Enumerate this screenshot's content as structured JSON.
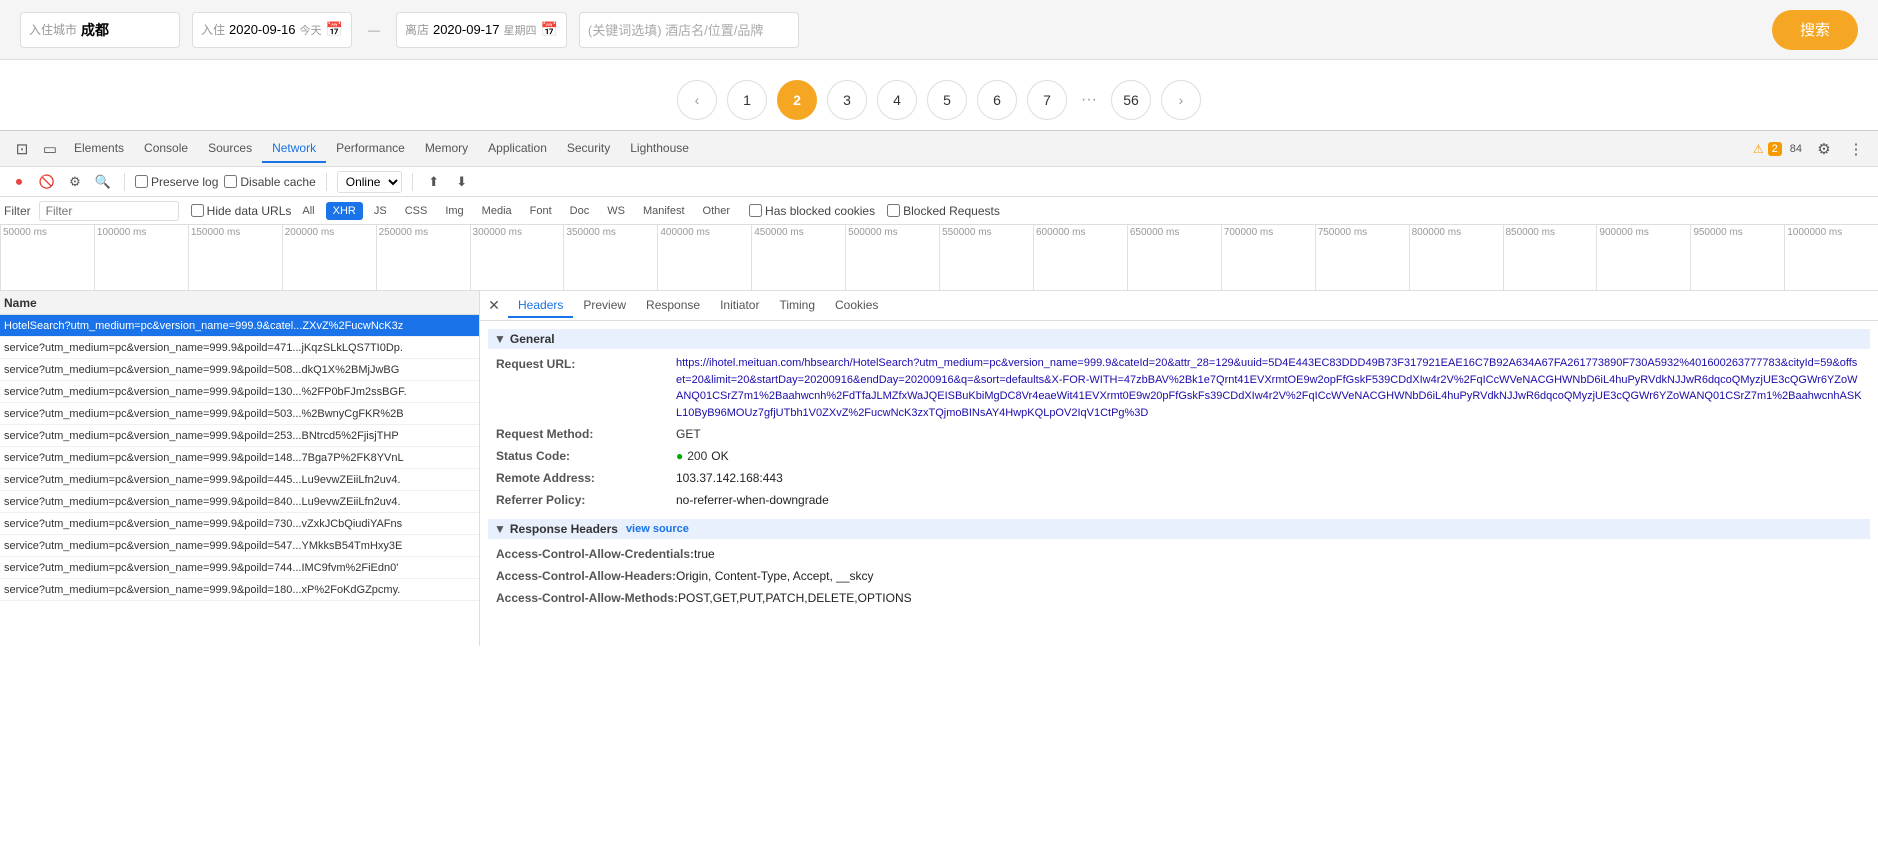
{
  "topbar": {
    "checkin_label": "入住城市",
    "checkin_city": "成都",
    "checkin_date_label": "入住",
    "checkin_date": "2020-09-16",
    "today_label": "今天",
    "checkout_label": "离店",
    "checkout_date": "2020-09-17",
    "checkout_day": "星期四",
    "keyword_placeholder": "(关键词选填) 酒店名/位置/品牌",
    "search_btn": "搜索"
  },
  "pagination": {
    "prev": "‹",
    "next": "›",
    "pages": [
      "1",
      "2",
      "3",
      "4",
      "5",
      "6",
      "7",
      "...",
      "56"
    ],
    "active_page": "2"
  },
  "devtools": {
    "tabs": [
      "Elements",
      "Console",
      "Sources",
      "Network",
      "Performance",
      "Memory",
      "Application",
      "Security",
      "Lighthouse"
    ],
    "active_tab": "Network",
    "warning_count": "2",
    "error_count": "84",
    "network_toolbar": {
      "preserve_log": "Preserve log",
      "disable_cache": "Disable cache",
      "throttle": "Online"
    },
    "filter_bar": {
      "label": "Filter",
      "hide_data_urls": "Hide data URLs",
      "all": "All",
      "xhr": "XHR",
      "js": "JS",
      "css": "CSS",
      "img": "Img",
      "media": "Media",
      "font": "Font",
      "doc": "Doc",
      "ws": "WS",
      "manifest": "Manifest",
      "other": "Other",
      "has_blocked": "Has blocked cookies",
      "blocked_requests": "Blocked Requests"
    },
    "timeline": {
      "ticks": [
        "50000 ms",
        "100000 ms",
        "150000 ms",
        "200000 ms",
        "250000 ms",
        "300000 ms",
        "350000 ms",
        "400000 ms",
        "450000 ms",
        "500000 ms",
        "550000 ms",
        "600000 ms",
        "650000 ms",
        "700000 ms",
        "750000 ms",
        "800000 ms",
        "850000 ms",
        "900000 ms",
        "950000 ms",
        "1000000 ms"
      ]
    },
    "list_header": "Name",
    "requests": [
      {
        "name": "HotelSearch?utm_medium=pc&version_name=999.9&catel...ZXvZ%2FucwNcK3z",
        "selected": true
      },
      {
        "name": "service?utm_medium=pc&version_name=999.9&poild=471...jKqzSLkLQS7TI0Dp.",
        "selected": false
      },
      {
        "name": "service?utm_medium=pc&version_name=999.9&poild=508...dkQ1X%2BMjJwBG",
        "selected": false
      },
      {
        "name": "service?utm_medium=pc&version_name=999.9&poild=130...%2FP0bFJm2ssBGF.",
        "selected": false
      },
      {
        "name": "service?utm_medium=pc&version_name=999.9&poild=503...%2BwnyCgFKR%2B",
        "selected": false
      },
      {
        "name": "service?utm_medium=pc&version_name=999.9&poild=253...BNtrcd5%2FjisjTHP",
        "selected": false
      },
      {
        "name": "service?utm_medium=pc&version_name=999.9&poild=148...7Bga7P%2FK8YVnL",
        "selected": false
      },
      {
        "name": "service?utm_medium=pc&version_name=999.9&poild=445...Lu9evwZEiiLfn2uv4.",
        "selected": false
      },
      {
        "name": "service?utm_medium=pc&version_name=999.9&poild=840...Lu9evwZEiiLfn2uv4.",
        "selected": false
      },
      {
        "name": "service?utm_medium=pc&version_name=999.9&poild=730...vZxkJCbQiudiYAFns",
        "selected": false
      },
      {
        "name": "service?utm_medium=pc&version_name=999.9&poild=547...YMkksB54TmHxy3E",
        "selected": false
      },
      {
        "name": "service?utm_medium=pc&version_name=999.9&poild=744...IMC9fvm%2FiEdn0'",
        "selected": false
      },
      {
        "name": "service?utm_medium=pc&version_name=999.9&poild=180...xP%2FoKdGZpcmy.",
        "selected": false
      }
    ],
    "details": {
      "tabs": [
        "Headers",
        "Preview",
        "Response",
        "Initiator",
        "Timing",
        "Cookies"
      ],
      "active_tab": "Headers",
      "general_section": "General",
      "request_url_label": "Request URL:",
      "request_url": "https://ihotel.meituan.com/hbsearch/HotelSearch?utm_medium=pc&version_name=999.9&cateId=20&attr_28=129&uuid=5D4E443EC83DDD49B73F317921EAE16C7B92A634A67FA261773890F730A5932%401600263777783&cityId=59&offset=20&limit=20&startDay=20200916&endDay=20200916&q=&sort=defaults&X-FOR-WITH=47zbBAV%2Bk1e7Qrnt41EVXrmtOE9w2opFfGskF539CDdXIw4r2V%2FqICcWVeNACGHWNbD6iL4huPyRVdkNJJwR6dqcoQMyzjUE3cQGWr6YZoWANQ01CSrZ7m1%2Baahwcnh%2FdTfaJLMZfxWaJQEISBuKbiMgDC8Vr4eaeWit41EVXrmt0E9w20pFfGskFs39CDdXIw4r2V%2FqICcWVeNACGHWNbD6iL4huPyRVdkNJJwR6dqcoQMyzjUE3cQGWr6YZoWANQ01CSrZ7m1%2BaahwcnhASKL10ByB96MOUz7gfjUTbh1V0ZXvZ%2FucwNcK3zxTQjmoBINsAY4HwpKQLpOV2IqV1CtPg%3D",
      "request_method_label": "Request Method:",
      "request_method": "GET",
      "status_code_label": "Status Code:",
      "status_indicator": "●",
      "status_code": "200",
      "status_text": "OK",
      "remote_address_label": "Remote Address:",
      "remote_address": "103.37.142.168:443",
      "referrer_policy_label": "Referrer Policy:",
      "referrer_policy": "no-referrer-when-downgrade",
      "response_headers_label": "Response Headers",
      "view_source": "view source",
      "response_headers": [
        {
          "key": "Access-Control-Allow-Credentials:",
          "val": "true"
        },
        {
          "key": "Access-Control-Allow-Headers:",
          "val": "Origin, Content-Type, Accept, __skcy"
        },
        {
          "key": "Access-Control-Allow-Methods:",
          "val": "POST,GET,PUT,PATCH,DELETE,OPTIONS"
        }
      ]
    }
  }
}
